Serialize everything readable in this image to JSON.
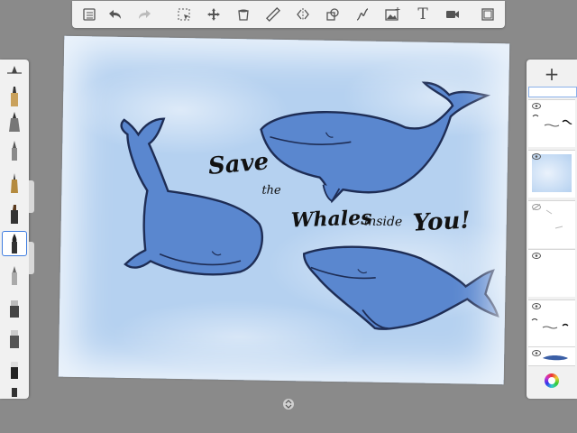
{
  "toolbar": {
    "tools": [
      {
        "icon": "gallery-list-icon"
      },
      {
        "icon": "undo-icon"
      },
      {
        "icon": "redo-icon"
      },
      {
        "icon": "selection-icon"
      },
      {
        "icon": "transform-move-icon"
      },
      {
        "icon": "fill-bucket-icon"
      },
      {
        "icon": "ruler-icon"
      },
      {
        "icon": "symmetry-icon"
      },
      {
        "icon": "shapes-icon"
      },
      {
        "icon": "curve-icon"
      },
      {
        "icon": "add-image-icon"
      },
      {
        "icon": "text-icon",
        "label": "T"
      },
      {
        "icon": "video-record-icon"
      },
      {
        "icon": "fullscreen-icon"
      }
    ]
  },
  "brushes": [
    {
      "name": "brush-size-slider"
    },
    {
      "name": "pencil"
    },
    {
      "name": "fine-pen"
    },
    {
      "name": "ballpoint"
    },
    {
      "name": "fineliner"
    },
    {
      "name": "marker"
    },
    {
      "name": "paintbrush",
      "selected": true
    },
    {
      "name": "airbrush"
    },
    {
      "name": "smudge"
    },
    {
      "name": "blender"
    },
    {
      "name": "eraser"
    }
  ],
  "layers": {
    "add_label": "+",
    "items": [
      {
        "thumb": "header"
      },
      {
        "thumb": "text-layer"
      },
      {
        "thumb": "sky-background"
      },
      {
        "thumb": "hidden-sketch"
      },
      {
        "thumb": "empty"
      },
      {
        "thumb": "text-layer-2"
      },
      {
        "thumb": "whale-layer"
      }
    ]
  },
  "canvas": {
    "text": {
      "save": "Save",
      "the": "the",
      "whales": "Whales",
      "inside": "inside",
      "you": "You!"
    },
    "colors": {
      "sky": "#b5d1f0",
      "whale": "#5a87cf",
      "outline": "#1e2d55"
    }
  }
}
